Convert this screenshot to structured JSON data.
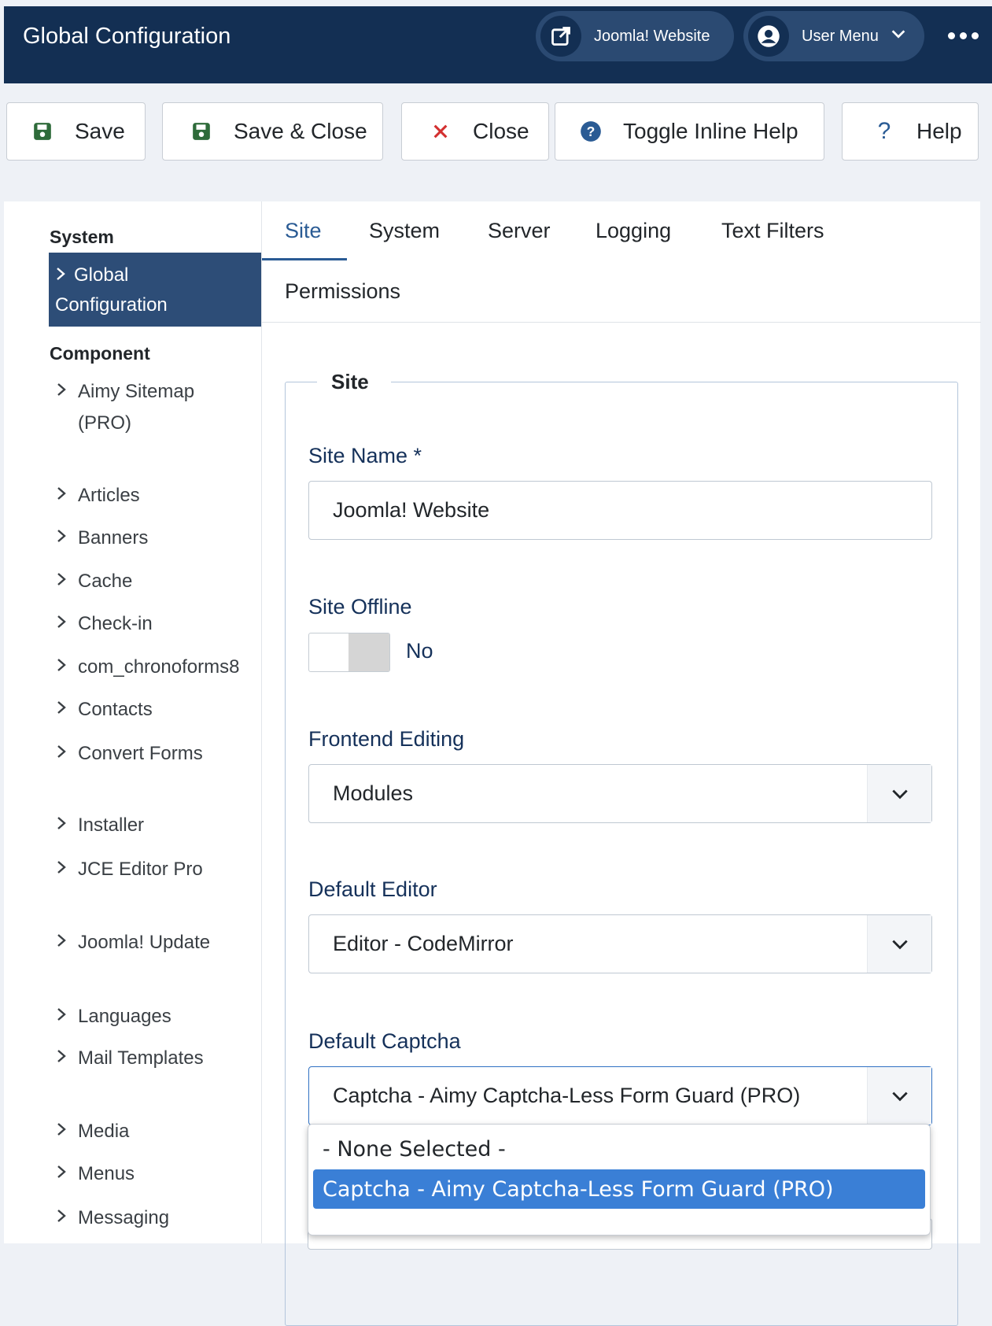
{
  "header": {
    "title": "Global Configuration",
    "site_link": "Joomla! Website",
    "user_menu": "User Menu"
  },
  "toolbar": {
    "save": "Save",
    "save_close": "Save & Close",
    "close": "Close",
    "toggle_help": "Toggle Inline Help",
    "help": "Help"
  },
  "sidebar": {
    "system_heading": "System",
    "active_item_line1": "Global",
    "active_item_line2": "Configuration",
    "component_heading": "Component",
    "items": [
      {
        "label": "Aimy Sitemap (PRO)"
      },
      {
        "label": "Articles"
      },
      {
        "label": "Banners"
      },
      {
        "label": "Cache"
      },
      {
        "label": "Check-in"
      },
      {
        "label": "com_chronoforms8"
      },
      {
        "label": "Contacts"
      },
      {
        "label": "Convert Forms"
      },
      {
        "label": "Installer"
      },
      {
        "label": "JCE Editor Pro"
      },
      {
        "label": "Joomla! Update"
      },
      {
        "label": "Languages"
      },
      {
        "label": "Mail Templates"
      },
      {
        "label": "Media"
      },
      {
        "label": "Menus"
      },
      {
        "label": "Messaging"
      }
    ]
  },
  "tabs": [
    {
      "label": "Site",
      "active": true
    },
    {
      "label": "System"
    },
    {
      "label": "Server"
    },
    {
      "label": "Logging"
    },
    {
      "label": "Text Filters"
    },
    {
      "label": "Permissions"
    }
  ],
  "form": {
    "legend": "Site",
    "site_name_label": "Site Name *",
    "site_name_value": "Joomla! Website",
    "site_offline_label": "Site Offline",
    "site_offline_value": "No",
    "frontend_editing_label": "Frontend Editing",
    "frontend_editing_value": "Modules",
    "default_editor_label": "Default Editor",
    "default_editor_value": "Editor - CodeMirror",
    "default_captcha_label": "Default Captcha",
    "default_captcha_value": "Captcha - Aimy Captcha-Less Form Guard (PRO)"
  },
  "captcha_dropdown": {
    "options": [
      {
        "label": "- None Selected -"
      },
      {
        "label": "Captcha - Aimy Captcha-Less Form Guard (PRO)",
        "selected": true
      }
    ]
  },
  "colors": {
    "header_bg": "#132f53",
    "accent": "#2a5b94",
    "sidebar_active": "#2d4d77",
    "selected_option": "#3a7fd6",
    "close_icon": "#d32f2f",
    "save_icon": "#2e6b3a"
  },
  "icons": {
    "external_link": "external-link-icon",
    "user": "user-circle-icon",
    "more": "more-dots-icon",
    "save": "floppy-disk-icon",
    "close": "x-icon",
    "info": "question-circle-icon",
    "help": "question-mark-icon",
    "chevron": "chevron-right-icon",
    "caret": "chevron-down-icon"
  }
}
